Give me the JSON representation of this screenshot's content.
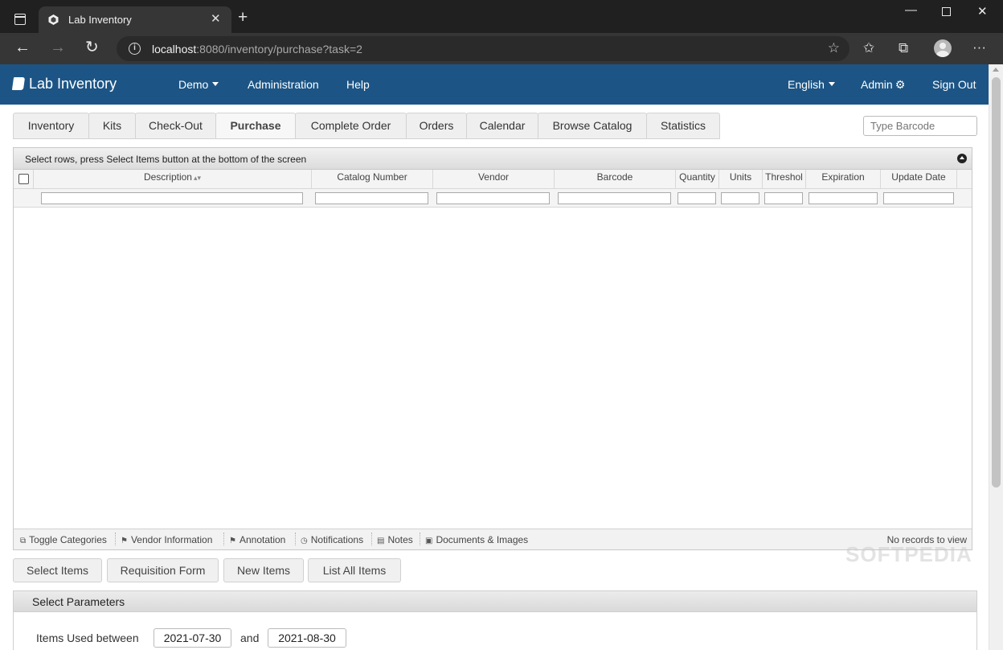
{
  "browser": {
    "tab_title": "Lab Inventory",
    "url_host": "localhost",
    "url_rest": ":8080/inventory/purchase?task=2"
  },
  "app": {
    "brand": "Lab Inventory",
    "nav": {
      "demo": "Demo",
      "administration": "Administration",
      "help": "Help",
      "language": "English",
      "admin": "Admin",
      "signout": "Sign Out"
    },
    "brand_color": "#1c5585"
  },
  "tabs": [
    "Inventory",
    "Kits",
    "Check-Out",
    "Purchase",
    "Complete Order",
    "Orders",
    "Calendar",
    "Browse Catalog",
    "Statistics"
  ],
  "active_tab": "Purchase",
  "barcode": {
    "placeholder": "Type Barcode"
  },
  "grid": {
    "caption": "Select rows, press Select Items button at the bottom of the screen",
    "columns": [
      "Description",
      "Catalog Number",
      "Vendor",
      "Barcode",
      "Quantity",
      "Units",
      "Threshol",
      "Expiration",
      "Update Date"
    ],
    "footer_items": [
      "Toggle Categories",
      "Vendor Information",
      "Annotation",
      "Notifications",
      "Notes",
      "Documents & Images"
    ],
    "status": "No records to view"
  },
  "buttons": [
    "Select Items",
    "Requisition Form",
    "New Items",
    "List All Items"
  ],
  "params": {
    "title": "Select Parameters",
    "label": "Items Used between",
    "from": "2021-07-30",
    "conj": "and",
    "to": "2021-08-30"
  },
  "watermark": "SOFTPEDIA"
}
